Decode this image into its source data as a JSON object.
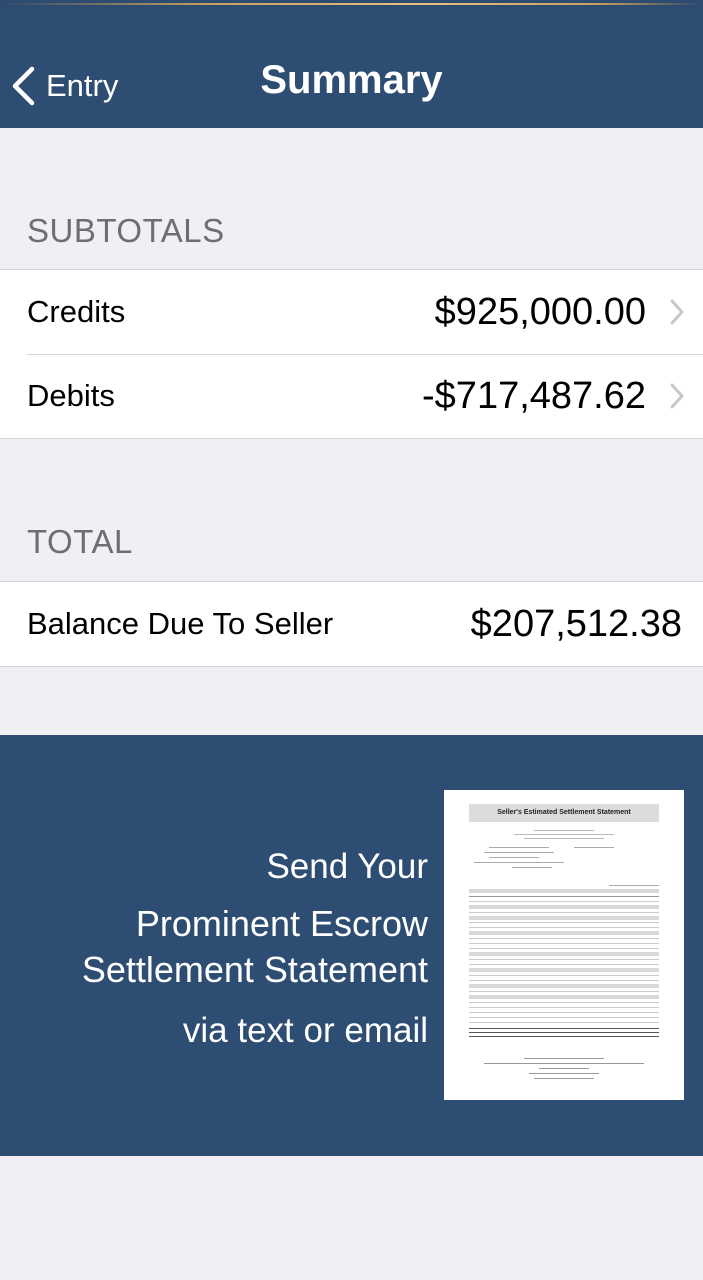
{
  "navbar": {
    "back_label": "Entry",
    "title": "Summary",
    "background": "#2e4d73"
  },
  "subtotals": {
    "header": "SUBTOTALS",
    "rows": [
      {
        "label": "Credits",
        "value": "$925,000.00",
        "icon": "chevron-right-icon"
      },
      {
        "label": "Debits",
        "value": "-$717,487.62",
        "icon": "chevron-right-icon"
      }
    ]
  },
  "total": {
    "header": "TOTAL",
    "row": {
      "label": "Balance Due To Seller",
      "value": "$207,512.38"
    }
  },
  "promo": {
    "line1": "Send Your",
    "line2": "Prominent Escrow",
    "line3": "Settlement Statement",
    "line4": "via text or email",
    "document": {
      "title": "Seller's Estimated Settlement Statement"
    }
  }
}
